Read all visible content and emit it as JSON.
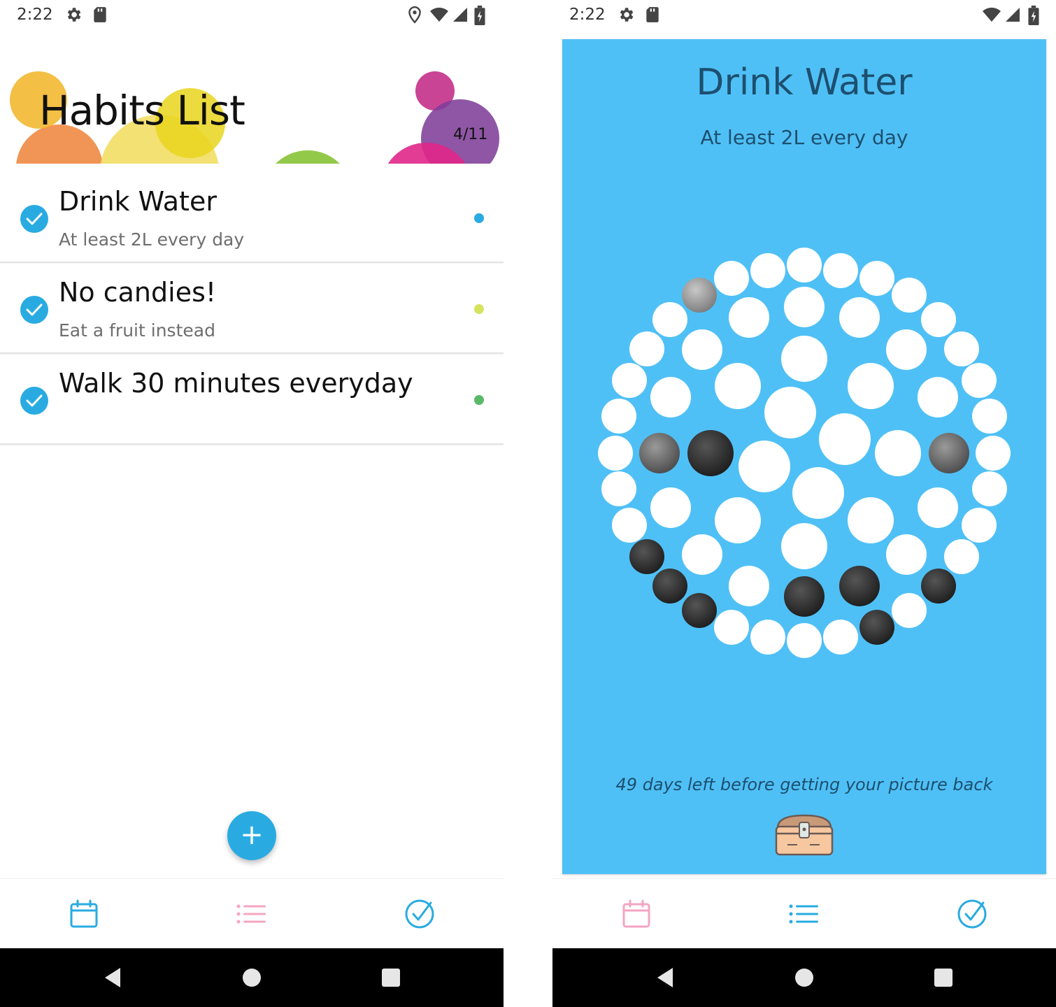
{
  "colors": {
    "accent": "#29abe2",
    "card_bg": "#4fc0f6",
    "dot_water": "#29abe2",
    "dot_candies": "#d5e35f",
    "dot_walk": "#5bb86a",
    "inactive_icon": "#f3a6c3"
  },
  "left": {
    "status": {
      "time": "2:22",
      "icons": [
        "gear-icon",
        "sd-card-icon",
        "location-icon",
        "wifi-icon",
        "signal-icon",
        "battery-icon"
      ]
    },
    "header": {
      "title": "Habits List",
      "counter": "4/11"
    },
    "habits": [
      {
        "title": "Drink Water",
        "subtitle": "At least 2L every day",
        "checked": true,
        "dot_color": "#29abe2"
      },
      {
        "title": "No candies!",
        "subtitle": "Eat a fruit instead",
        "checked": true,
        "dot_color": "#d5e35f"
      },
      {
        "title": "Walk 30 minutes everyday",
        "subtitle": "",
        "checked": true,
        "dot_color": "#5bb86a"
      }
    ],
    "fab_label": "+",
    "bottom_nav": [
      {
        "name": "calendar-icon",
        "active": true
      },
      {
        "name": "list-icon",
        "active": false
      },
      {
        "name": "check-circle-icon",
        "active": true
      }
    ]
  },
  "right": {
    "status": {
      "time": "2:22",
      "icons": [
        "gear-icon",
        "sd-card-icon",
        "wifi-icon",
        "signal-icon",
        "battery-icon"
      ]
    },
    "detail": {
      "title": "Drink Water",
      "subtitle": "At least 2L every day",
      "footer": "49 days left before getting your picture back",
      "reward_icon": "treasure-chest-icon",
      "revealed_tiles": 11,
      "total_tiles": 60
    },
    "bottom_nav": [
      {
        "name": "calendar-icon",
        "active": false
      },
      {
        "name": "list-icon",
        "active": true
      },
      {
        "name": "check-circle-icon",
        "active": true
      }
    ]
  },
  "system_nav": [
    "back-icon",
    "home-icon",
    "recents-icon"
  ]
}
